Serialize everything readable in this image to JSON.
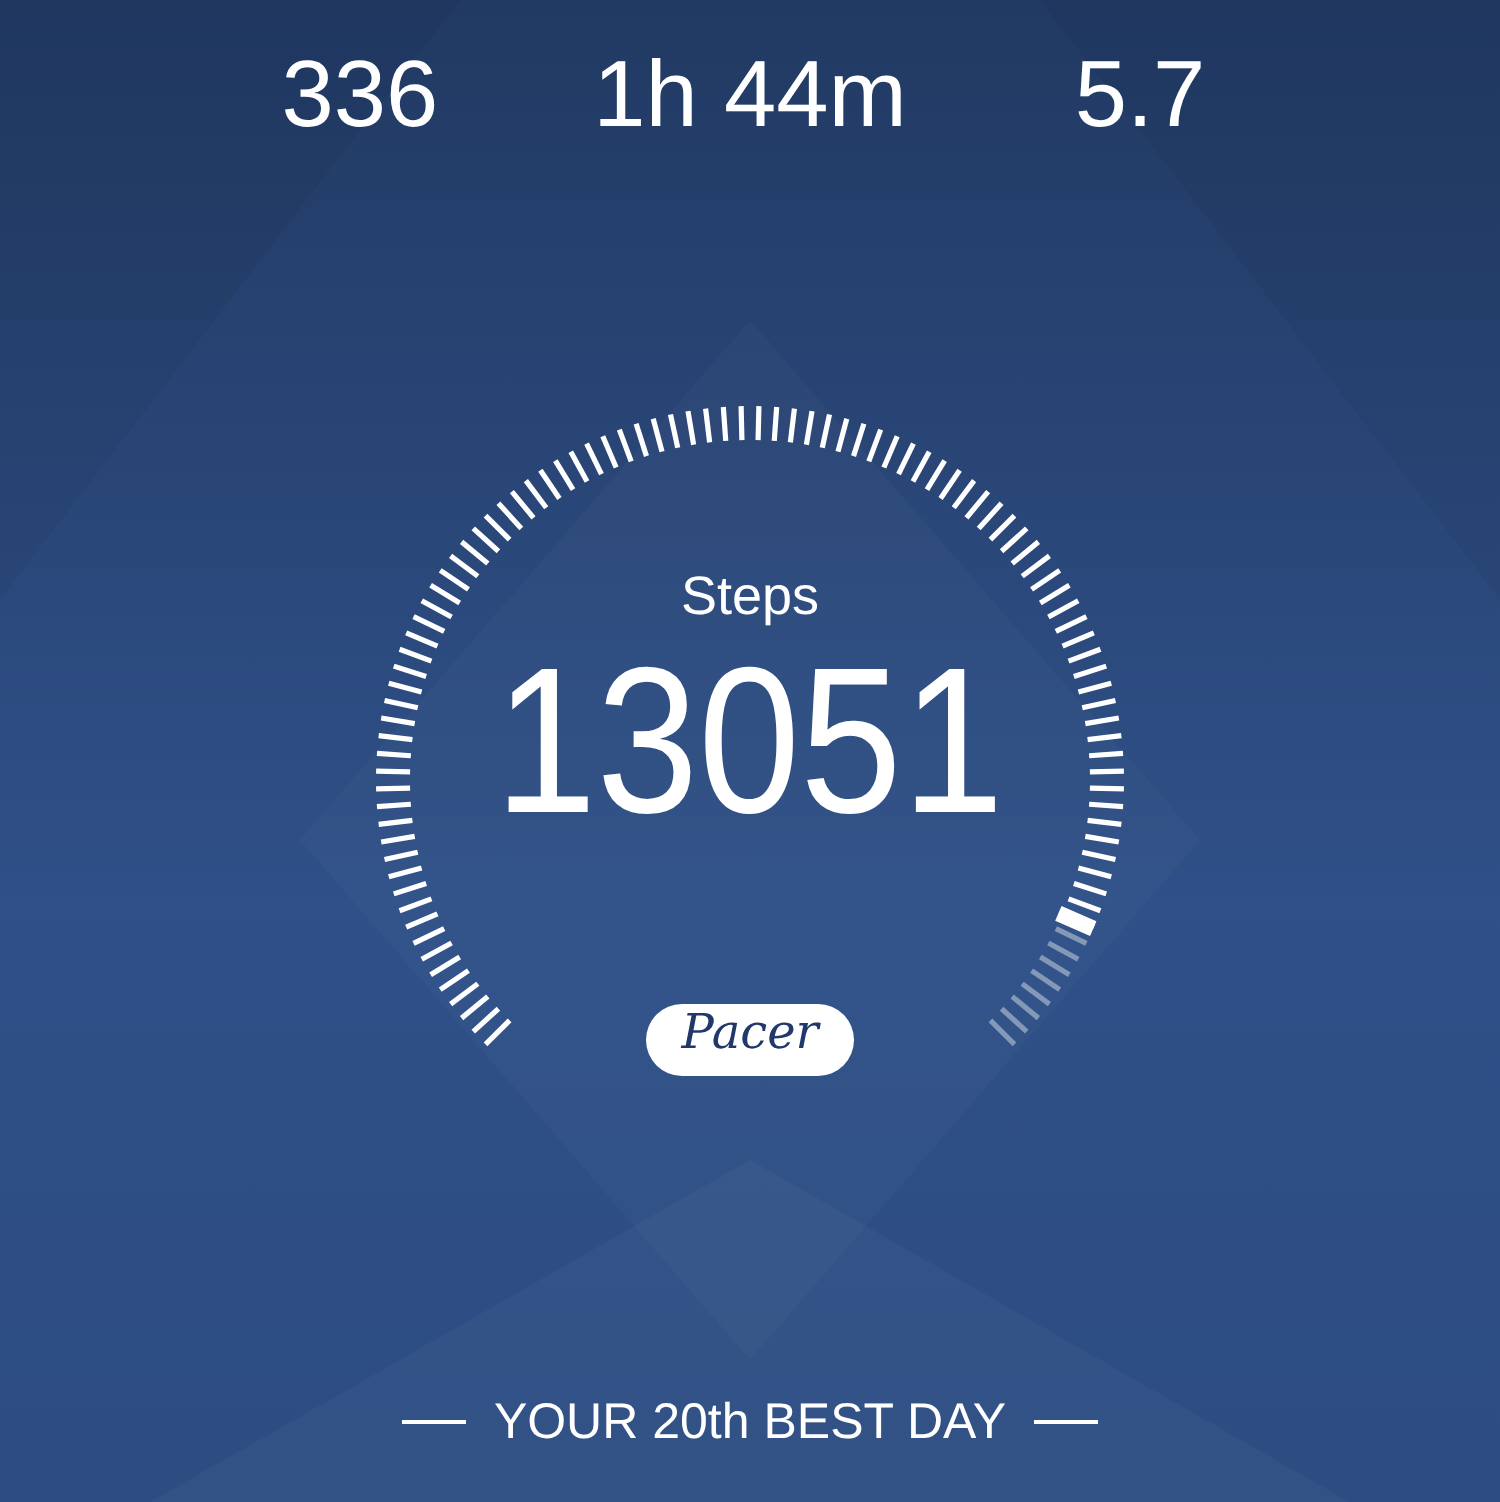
{
  "stats": [
    {
      "value": "336"
    },
    {
      "value": "1h 44m"
    },
    {
      "value": "5.7"
    }
  ],
  "gauge": {
    "label": "Steps",
    "value": "13051"
  },
  "logo": {
    "text": "Pacer"
  },
  "rank": {
    "text": "YOUR 20th BEST DAY"
  }
}
